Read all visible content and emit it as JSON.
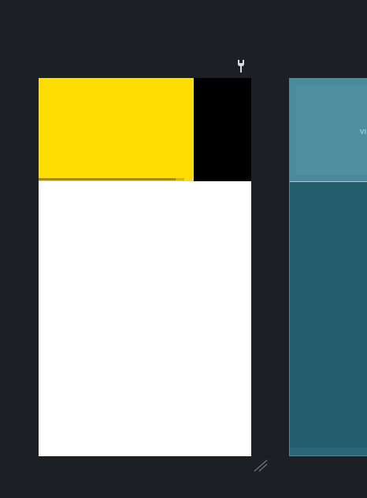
{
  "toolbar": {
    "tool_icon": "wrench-icon"
  },
  "device_preview": {
    "progress": 0.94,
    "header_color": "#ffdd00",
    "background_color": "#000000",
    "content_color": "#ffffff"
  },
  "resize_handle": {
    "icon": "resize-grip-icon"
  },
  "side_panel": {
    "label": "VI",
    "accent_color": "#4a8a9d",
    "body_color": "#235d6e"
  }
}
